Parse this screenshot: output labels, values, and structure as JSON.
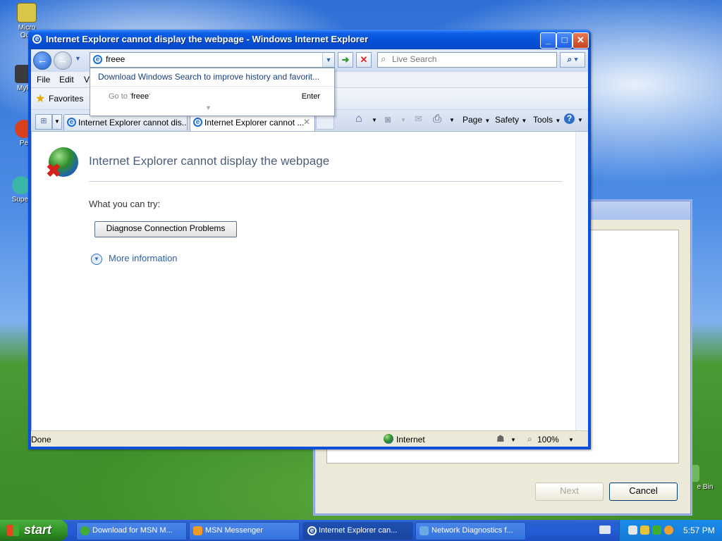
{
  "desktop": {
    "icons": [
      {
        "label": "Micro Outl"
      },
      {
        "label": "MyP"
      },
      {
        "label": "Pe"
      },
      {
        "label": "Super"
      }
    ],
    "recycle_label": "e Bin"
  },
  "background_dialog": {
    "next_label": "Next",
    "cancel_label": "Cancel"
  },
  "ie": {
    "title": "Internet Explorer cannot display the webpage - Windows Internet Explorer",
    "address_value": "freee",
    "search_placeholder": "Live Search",
    "menu": {
      "file": "File",
      "edit": "Edit",
      "view": "Vi"
    },
    "favorites_label": "Favorites",
    "tabs": [
      {
        "label": "Internet Explorer cannot dis..."
      },
      {
        "label": "Internet Explorer cannot ..."
      }
    ],
    "commands": {
      "page": "Page",
      "safety": "Safety",
      "tools": "Tools"
    },
    "dropdown": {
      "suggestion": "Download Windows Search to improve history and favorit...",
      "goto_prefix": "Go to '",
      "goto_term": "freee",
      "goto_suffix": "'",
      "enter": "Enter"
    },
    "content": {
      "heading": "Internet Explorer cannot display the webpage",
      "what_you_can_try": "What you can try:",
      "diagnose_button": "Diagnose Connection Problems",
      "more_info": "More information"
    },
    "status": {
      "left": "Done",
      "zone": "Internet",
      "zoom": "100%"
    }
  },
  "taskbar": {
    "start_label": "start",
    "tasks": [
      {
        "label": "Download for MSN M..."
      },
      {
        "label": "MSN Messenger"
      },
      {
        "label": "Internet Explorer can..."
      },
      {
        "label": "Network Diagnostics f..."
      }
    ],
    "clock": "5:57 PM"
  },
  "colors": {
    "xp_blue": "#0a50d8",
    "taskbar_blue": "#245dd7",
    "start_green": "#3fae2f",
    "link_blue": "#2a63a8"
  }
}
